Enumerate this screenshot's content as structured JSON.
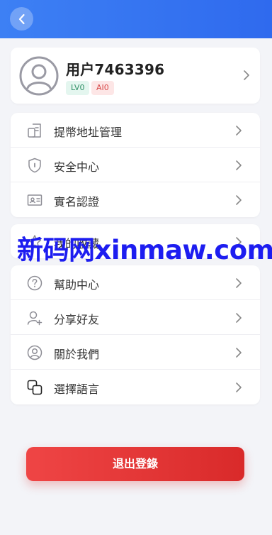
{
  "header": {
    "back_icon": "chevron-left-icon"
  },
  "profile": {
    "username": "用户7463396",
    "badges": [
      "LV0",
      "AI0"
    ],
    "avatar_icon": "user-avatar-icon"
  },
  "menu": {
    "group1": [
      {
        "label": "提幣地址管理",
        "icon": "wallet-address-icon"
      },
      {
        "label": "安全中心",
        "icon": "shield-icon"
      },
      {
        "label": "實名認證",
        "icon": "id-card-icon"
      }
    ],
    "group2": [
      {
        "label": "我的收藏",
        "icon": "star-icon"
      }
    ],
    "group3": [
      {
        "label": "幫助中心",
        "icon": "help-circle-icon"
      },
      {
        "label": "分享好友",
        "icon": "user-plus-icon"
      },
      {
        "label": "關於我們",
        "icon": "user-circle-icon"
      },
      {
        "label": "選擇語言",
        "icon": "copy-squares-icon"
      }
    ]
  },
  "watermark": "新码网xinmaw.com",
  "logout_label": "退出登錄",
  "colors": {
    "header": "#3d80f4",
    "logout": "#e23535",
    "watermark": "#1d1df0"
  }
}
